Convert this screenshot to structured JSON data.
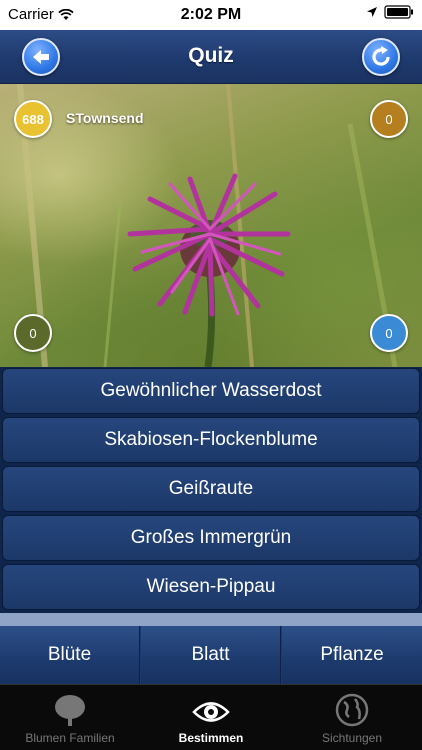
{
  "status_bar": {
    "carrier": "Carrier",
    "time": "2:02 PM"
  },
  "nav": {
    "title": "Quiz",
    "back_icon": "back-arrow-icon",
    "refresh_icon": "refresh-icon"
  },
  "photo": {
    "user_score": "688",
    "username": "STownsend",
    "top_right_score": "0",
    "bottom_left_score": "0",
    "bottom_right_score": "0"
  },
  "answers": [
    "Gewöhnlicher Wasserdost",
    "Skabiosen-Flockenblume",
    "Geißraute",
    "Großes Immergrün",
    "Wiesen-Pippau"
  ],
  "segments": [
    "Blüte",
    "Blatt",
    "Pflanze"
  ],
  "tabbar": [
    {
      "label": "Blumen Familien",
      "icon": "tree-icon"
    },
    {
      "label": "Bestimmen",
      "icon": "eye-icon"
    },
    {
      "label": "Sichtungen",
      "icon": "globe-icon"
    }
  ]
}
